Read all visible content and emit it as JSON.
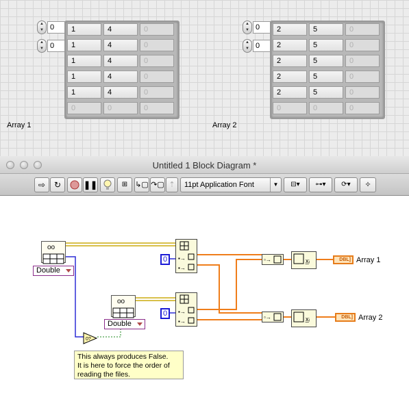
{
  "front_panel": {
    "array1": {
      "label": "Array 1",
      "index_row": "0",
      "index_col": "0",
      "rows": [
        [
          "1",
          "4",
          "0"
        ],
        [
          "1",
          "4",
          "0"
        ],
        [
          "1",
          "4",
          "0"
        ],
        [
          "1",
          "4",
          "0"
        ],
        [
          "1",
          "4",
          "0"
        ],
        [
          "0",
          "0",
          "0"
        ]
      ]
    },
    "array2": {
      "label": "Array 2",
      "index_row": "0",
      "index_col": "0",
      "rows": [
        [
          "2",
          "5",
          "0"
        ],
        [
          "2",
          "5",
          "0"
        ],
        [
          "2",
          "5",
          "0"
        ],
        [
          "2",
          "5",
          "0"
        ],
        [
          "2",
          "5",
          "0"
        ],
        [
          "0",
          "0",
          "0"
        ]
      ]
    }
  },
  "window": {
    "title": "Untitled 1 Block Diagram *"
  },
  "toolbar": {
    "font_label": "11pt Application Font",
    "buttons": [
      "run-continuously",
      "abort",
      "pause",
      "highlight-execution",
      "retain-wire-values",
      "step-into",
      "step-over",
      "step-out",
      "align",
      "distribute",
      "reorder",
      "cleanup"
    ]
  },
  "diagram": {
    "ring1": "Double",
    "ring2": "Double",
    "const1": "0",
    "const2": "0",
    "ind1_badge": "DBL]",
    "ind1_label": "Array 1",
    "ind2_badge": "DBL]",
    "ind2_label": "Array 2",
    "note_lines": [
      "This always produces False.",
      "It is here to force the order of",
      "reading the files."
    ]
  },
  "colors": {
    "wire_orange": "#ef7d1a",
    "wire_yellow": "#d8c04a",
    "wire_blue": "#2b2bd6",
    "wire_green": "#1f8a1f",
    "ring_border": "#8b2d8b"
  }
}
